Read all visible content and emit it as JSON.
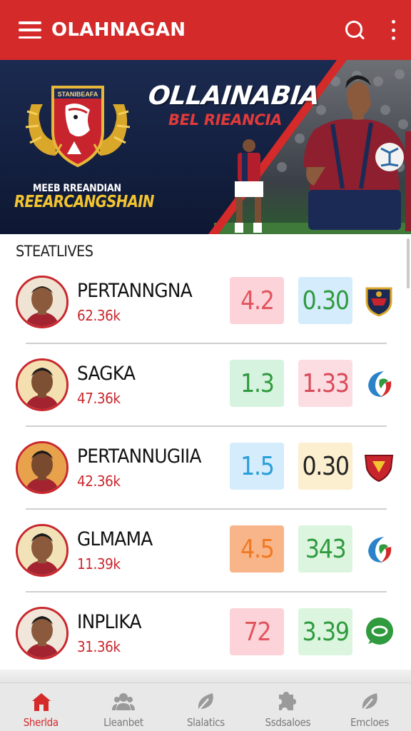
{
  "app_bar": {
    "title": "OLAHNAGAN",
    "menu_icon": "hamburger-menu-icon",
    "search_icon": "search-icon",
    "more_icon": "more-vertical-icon"
  },
  "banner": {
    "title": "OLLAINABIA",
    "subtitle": "BEL RIEANCIA",
    "crest_text": "STANIBEAFA",
    "tagline": "MEEB RREANDIAN",
    "slogan": "REEARCANGSHAIN"
  },
  "stats": {
    "heading": "STEATLIVES",
    "rows": [
      {
        "name": "PERTANNGNA",
        "sub": "62.36k",
        "stat_a": "4.2",
        "stat_b": "0.30",
        "badge": "shield-badge-icon"
      },
      {
        "name": "SAGKA",
        "sub": "47.36k",
        "stat_a": "1.3",
        "stat_b": "1.33",
        "badge": "swirl-badge-icon"
      },
      {
        "name": "PERTANNUGIIA",
        "sub": "42.36k",
        "stat_a": "1.5",
        "stat_b": "0.30",
        "badge": "red-shield-badge-icon"
      },
      {
        "name": "GLMAMA",
        "sub": "11.39k",
        "stat_a": "4.5",
        "stat_b": "343",
        "badge": "swirl-badge-icon"
      },
      {
        "name": "INPLIKA",
        "sub": "31.36k",
        "stat_a": "72",
        "stat_b": "3.39",
        "badge": "chat-bubble-badge-icon"
      }
    ]
  },
  "bottom_nav": {
    "items": [
      {
        "label": "Sherlda",
        "icon": "home-icon",
        "active": true
      },
      {
        "label": "Lleanbet",
        "icon": "people-icon",
        "active": false
      },
      {
        "label": "Slalatics",
        "icon": "leaf-icon",
        "active": false
      },
      {
        "label": "Ssdsaloes",
        "icon": "puzzle-icon",
        "active": false
      },
      {
        "label": "Emcloes",
        "icon": "leaf-icon",
        "active": false
      }
    ]
  },
  "colors": {
    "brand_red": "#d42a2a",
    "banner_navy": "#14213f",
    "slogan_gold": "#f3c431",
    "stat_red_bg": "#fbd3d8",
    "stat_red_text": "#e2555f",
    "stat_blue_bg": "#d4ecfb",
    "stat_blue_text": "#2a9fd8",
    "stat_green_bg": "#d6f3df",
    "stat_green_text": "#2f9a3e",
    "stat_pink_bg": "#fbdde2",
    "stat_pink_text": "#d94a5a",
    "stat_cream_bg": "#fbefcf",
    "stat_cream_text": "#222222",
    "stat_orange_bg": "#f9b58a",
    "stat_orange_text": "#f07a22",
    "stat_lightgreen_bg": "#dcf5df"
  }
}
